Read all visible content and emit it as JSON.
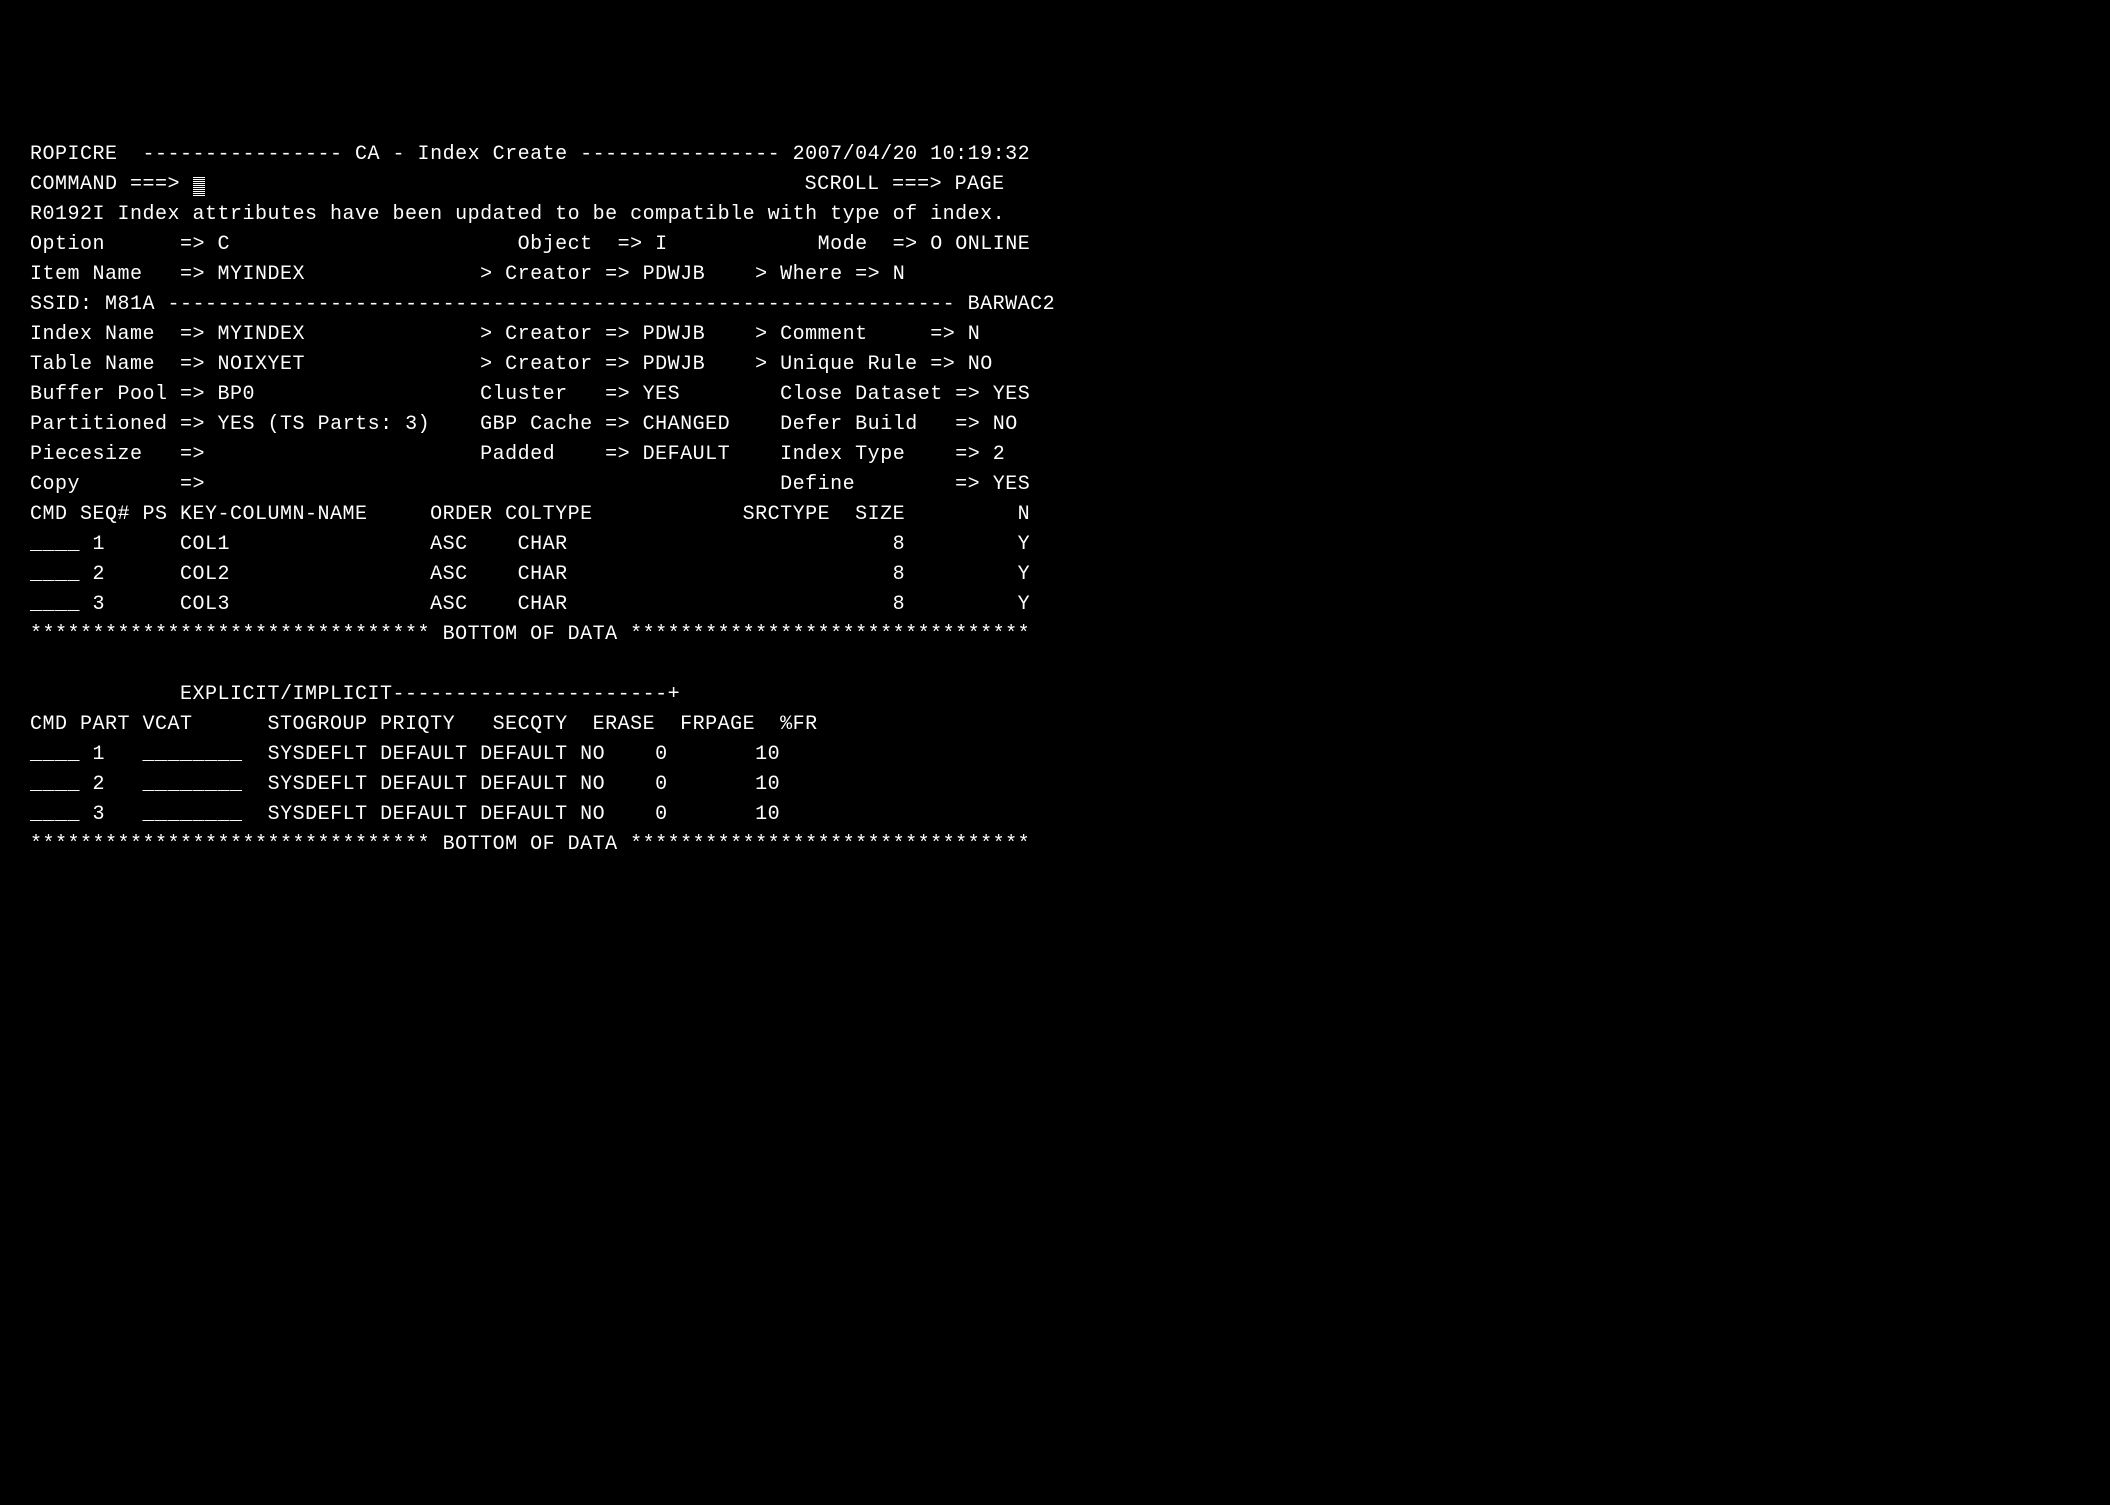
{
  "header": {
    "panel_id": "ROPICRE",
    "dash_left": "----------------",
    "title": "CA - Index Create",
    "dash_right": "----------------",
    "datetime": "2007/04/20 10:19:32"
  },
  "command": {
    "label": "COMMAND ===>",
    "value": "",
    "scroll_label": "SCROLL ===>",
    "scroll_value": "PAGE"
  },
  "message": "R0192I Index attributes have been updated to be compatible with type of index.",
  "fields": {
    "option_label": "Option",
    "option_arrow": "=>",
    "option_value": "C",
    "object_label": "Object",
    "object_arrow": "=>",
    "object_value": "I",
    "mode_label": "Mode",
    "mode_arrow": "=>",
    "mode_value": "O ONLINE",
    "item_name_label": "Item Name",
    "item_name_arrow": "=>",
    "item_name_value": "MYINDEX",
    "item_creator_label": "> Creator =>",
    "item_creator_value": "PDWJB",
    "item_where_label": "> Where =>",
    "item_where_value": "N"
  },
  "ssid": {
    "label": "SSID:",
    "value": "M81A",
    "dashes": "---------------------------------------------------------------",
    "user": "BARWAC2"
  },
  "index": {
    "index_name_label": "Index Name",
    "index_name_arrow": "=>",
    "index_name_value": "MYINDEX",
    "index_creator_label": "> Creator =>",
    "index_creator_value": "PDWJB",
    "comment_label": "> Comment",
    "comment_arrow": "=>",
    "comment_value": "N",
    "table_name_label": "Table Name",
    "table_name_arrow": "=>",
    "table_name_value": "NOIXYET",
    "table_creator_label": "> Creator =>",
    "table_creator_value": "PDWJB",
    "unique_rule_label": "> Unique Rule",
    "unique_rule_arrow": "=>",
    "unique_rule_value": "NO",
    "buffer_pool_label": "Buffer Pool",
    "buffer_pool_arrow": "=>",
    "buffer_pool_value": "BP0",
    "cluster_label": "Cluster",
    "cluster_arrow": "=>",
    "cluster_value": "YES",
    "close_dataset_label": "Close Dataset",
    "close_dataset_arrow": "=>",
    "close_dataset_value": "YES",
    "partitioned_label": "Partitioned",
    "partitioned_arrow": "=>",
    "partitioned_value": "YES (TS Parts: 3)",
    "gbp_cache_label": "GBP Cache",
    "gbp_cache_arrow": "=>",
    "gbp_cache_value": "CHANGED",
    "defer_build_label": "Defer Build",
    "defer_build_arrow": "=>",
    "defer_build_value": "NO",
    "piecesize_label": "Piecesize",
    "piecesize_arrow": "=>",
    "piecesize_value": "",
    "padded_label": "Padded",
    "padded_arrow": "=>",
    "padded_value": "DEFAULT",
    "index_type_label": "Index Type",
    "index_type_arrow": "=>",
    "index_type_value": "2",
    "copy_label": "Copy",
    "copy_arrow": "=>",
    "copy_value": "",
    "define_label": "Define",
    "define_arrow": "=>",
    "define_value": "YES"
  },
  "columns_header": {
    "cmd": "CMD",
    "seq": "SEQ#",
    "ps": "PS",
    "key_column_name": "KEY-COLUMN-NAME",
    "order": "ORDER",
    "coltype": "COLTYPE",
    "srctype": "SRCTYPE",
    "size": "SIZE",
    "n": "N"
  },
  "columns": [
    {
      "cmd": "____",
      "seq": "1",
      "ps": "",
      "name": "COL1",
      "order": "ASC",
      "coltype": "CHAR",
      "srctype": "",
      "size": "8",
      "n": "Y"
    },
    {
      "cmd": "____",
      "seq": "2",
      "ps": "",
      "name": "COL2",
      "order": "ASC",
      "coltype": "CHAR",
      "srctype": "",
      "size": "8",
      "n": "Y"
    },
    {
      "cmd": "____",
      "seq": "3",
      "ps": "",
      "name": "COL3",
      "order": "ASC",
      "coltype": "CHAR",
      "srctype": "",
      "size": "8",
      "n": "Y"
    }
  ],
  "bottom1": "******************************** BOTTOM OF DATA ********************************",
  "explicit_implicit": {
    "label": "EXPLICIT/IMPLICIT",
    "dashes": "----------------------+"
  },
  "parts_header": {
    "cmd": "CMD",
    "part": "PART",
    "vcat": "VCAT",
    "stogroup": "STOGROUP",
    "priqty": "PRIQTY",
    "secqty": "SECQTY",
    "erase": "ERASE",
    "frpage": "FRPAGE",
    "pctfr": "%FR"
  },
  "parts": [
    {
      "cmd": "____",
      "part": "1",
      "vcat": "________",
      "stogroup": "SYSDEFLT",
      "priqty": "DEFAULT",
      "secqty": "DEFAULT",
      "erase": "NO",
      "frpage": "0",
      "pctfr": "10"
    },
    {
      "cmd": "____",
      "part": "2",
      "vcat": "________",
      "stogroup": "SYSDEFLT",
      "priqty": "DEFAULT",
      "secqty": "DEFAULT",
      "erase": "NO",
      "frpage": "0",
      "pctfr": "10"
    },
    {
      "cmd": "____",
      "part": "3",
      "vcat": "________",
      "stogroup": "SYSDEFLT",
      "priqty": "DEFAULT",
      "secqty": "DEFAULT",
      "erase": "NO",
      "frpage": "0",
      "pctfr": "10"
    }
  ],
  "bottom2": "******************************** BOTTOM OF DATA ********************************"
}
